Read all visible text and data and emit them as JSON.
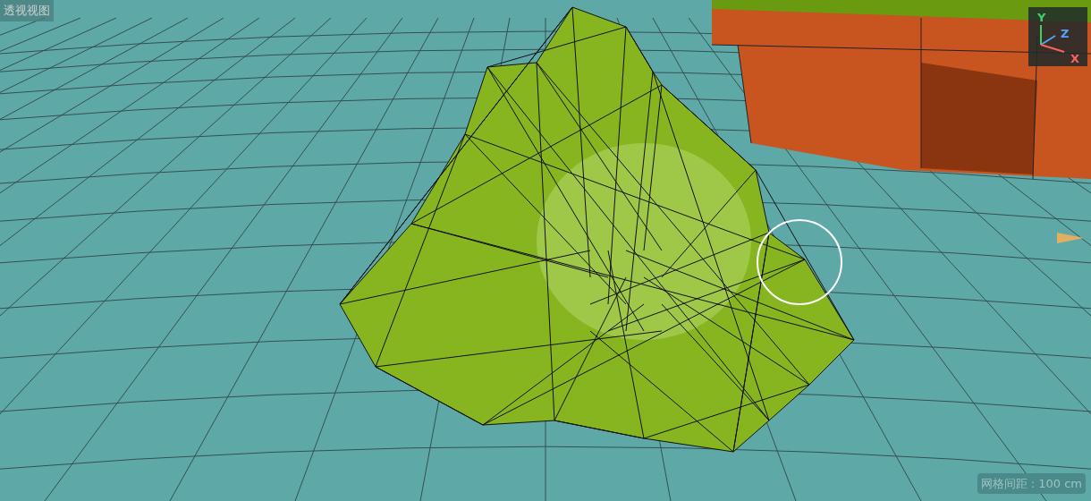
{
  "viewport": {
    "title": "透视视图",
    "grid_spacing": "网格间距 : 100 cm",
    "axes": [
      {
        "label": "Y",
        "color": "#3fd06a"
      },
      {
        "label": "Z",
        "color": "#5aa0ff"
      },
      {
        "label": "X",
        "color": "#ff6060"
      }
    ]
  }
}
